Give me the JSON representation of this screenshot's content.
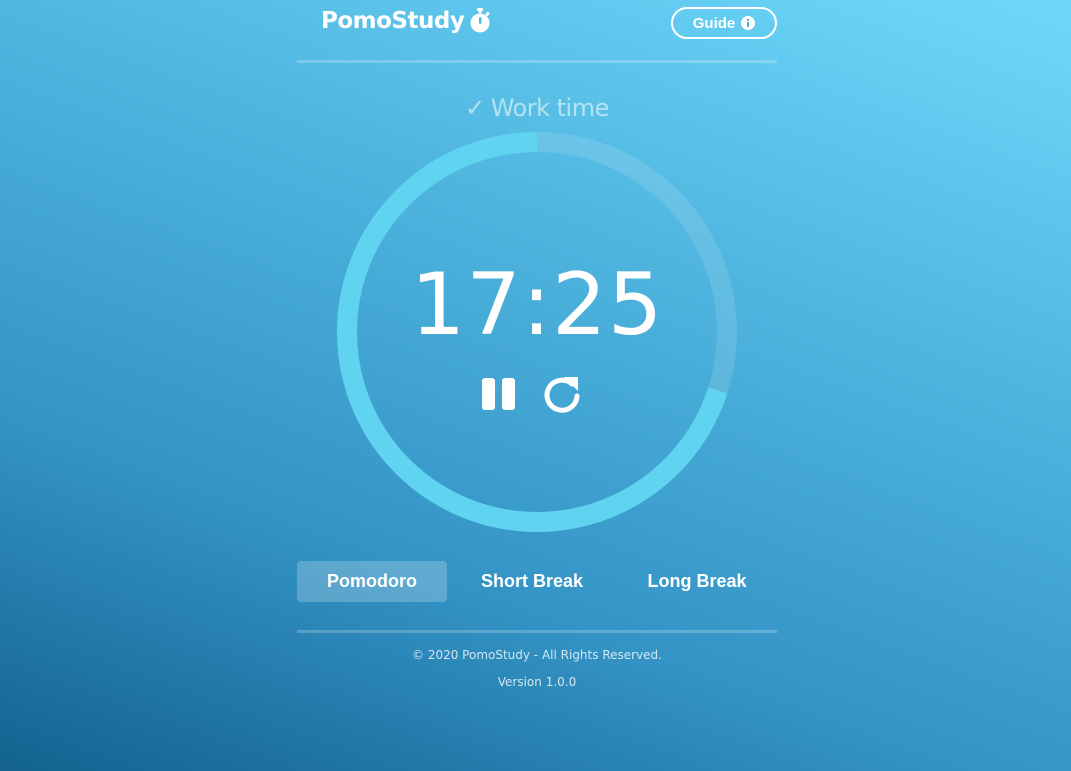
{
  "header": {
    "logo_text": "PomoStudy",
    "logo_icon": "stopwatch-icon",
    "guide_label": "Guide",
    "guide_icon": "info-icon"
  },
  "status": {
    "check_glyph": "✓",
    "label": "Work time"
  },
  "timer": {
    "time": "17:25",
    "progress_remaining_fraction": 0.7,
    "pause_icon": "pause-icon",
    "reset_icon": "reset-icon"
  },
  "modes": {
    "items": [
      {
        "label": "Pomodoro",
        "active": true
      },
      {
        "label": "Short Break",
        "active": false
      },
      {
        "label": "Long Break",
        "active": false
      }
    ]
  },
  "footer": {
    "copyright": "© 2020 PomoStudy - All Rights Reserved.",
    "version": "Version 1.0.0"
  },
  "colors": {
    "ring_progress": "#5fd3f0",
    "ring_track": "rgba(255,255,255,0.12)",
    "text": "#ffffff"
  }
}
